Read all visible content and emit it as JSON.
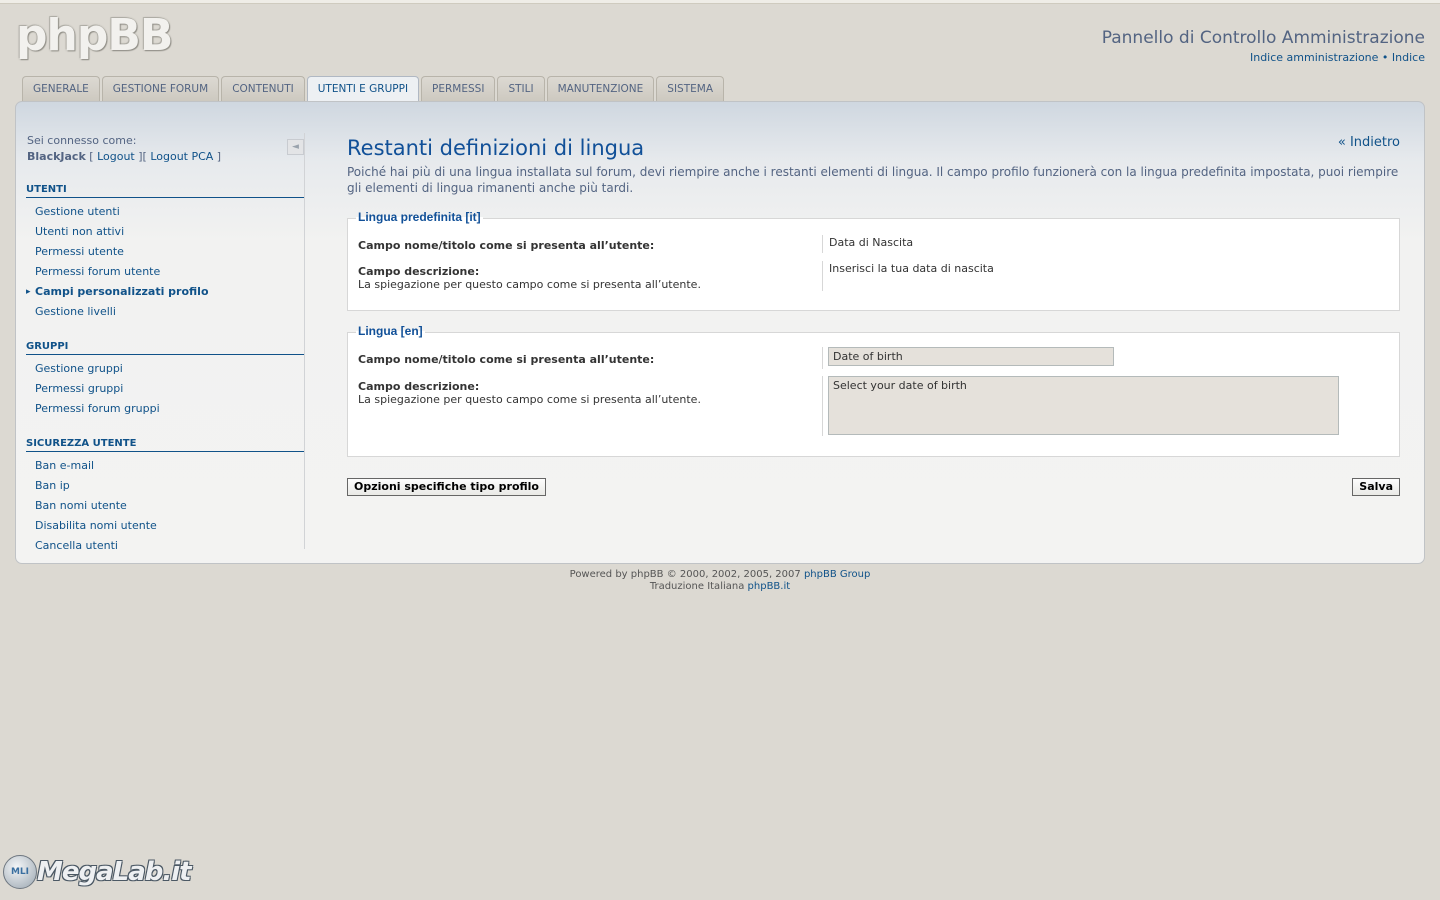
{
  "header": {
    "logo": "phpBB",
    "acp_title": "Pannello di Controllo Amministrazione",
    "link_admin_index": "Indice amministrazione",
    "separator": "•",
    "link_index": "Indice"
  },
  "tabs": [
    {
      "label": "GENERALE"
    },
    {
      "label": "GESTIONE FORUM"
    },
    {
      "label": "CONTENUTI"
    },
    {
      "label": "UTENTI E GRUPPI",
      "active": true
    },
    {
      "label": "PERMESSI"
    },
    {
      "label": "STILI"
    },
    {
      "label": "MANUTENZIONE"
    },
    {
      "label": "SISTEMA"
    }
  ],
  "sidebar": {
    "logged_in_label": "Sei connesso come:",
    "username": "BlackJack",
    "logout": "Logout",
    "logout_acp": "Logout PCA",
    "collapse_icon": "◄",
    "sections": [
      {
        "heading": "UTENTI",
        "items": [
          "Gestione utenti",
          "Utenti non attivi",
          "Permessi utente",
          "Permessi forum utente",
          "Campi personalizzati profilo",
          "Gestione livelli"
        ]
      },
      {
        "heading": "GRUPPI",
        "items": [
          "Gestione gruppi",
          "Permessi gruppi",
          "Permessi forum gruppi"
        ]
      },
      {
        "heading": "SICUREZZA UTENTE",
        "items": [
          "Ban e-mail",
          "Ban ip",
          "Ban nomi utente",
          "Disabilita nomi utente",
          "Cancella utenti"
        ]
      }
    ],
    "active_item": "Campi personalizzati profilo"
  },
  "main": {
    "back_link": "« Indietro",
    "title": "Restanti definizioni di lingua",
    "intro": "Poiché hai più di una lingua installata sul forum, devi riempire anche i restanti elementi di lingua. Il campo profilo funzionerà con la lingua predefinita impostata, puoi riempire gli elementi di lingua rimanenti anche più tardi.",
    "default_lang": {
      "legend": "Lingua predefinita [it]",
      "name_label": "Campo nome/titolo come si presenta all’utente:",
      "name_value": "Data di Nascita",
      "desc_label": "Campo descrizione:",
      "desc_explain": "La spiegazione per questo campo come si presenta all’utente.",
      "desc_value": "Inserisci la tua data di nascita"
    },
    "other_lang": {
      "legend": "Lingua [en]",
      "name_label": "Campo nome/titolo come si presenta all’utente:",
      "name_value": "Date of birth",
      "desc_label": "Campo descrizione:",
      "desc_explain": "La spiegazione per questo campo come si presenta all’utente.",
      "desc_value": "Select your date of birth"
    },
    "btn_profile_options": "Opzioni specifiche tipo profilo",
    "btn_save": "Salva"
  },
  "footer": {
    "line1_prefix": "Powered by phpBB © 2000, 2002, 2005, 2007",
    "line1_link": "phpBB Group",
    "line2_prefix": "Traduzione Italiana",
    "line2_link": "phpBB.it"
  },
  "watermark": {
    "badge": "MLI",
    "text": "MegaLab.it"
  }
}
